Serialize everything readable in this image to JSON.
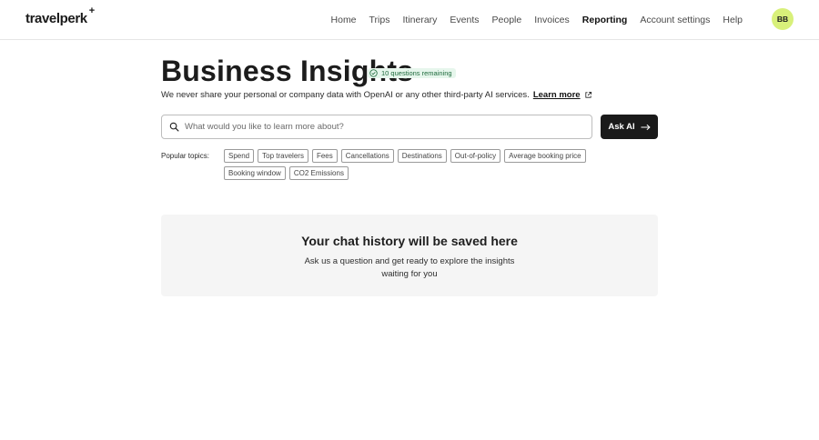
{
  "header": {
    "logo": "travelperk",
    "logo_plus": "+",
    "nav": [
      {
        "label": "Home",
        "active": false
      },
      {
        "label": "Trips",
        "active": false
      },
      {
        "label": "Itinerary",
        "active": false
      },
      {
        "label": "Events",
        "active": false
      },
      {
        "label": "People",
        "active": false
      },
      {
        "label": "Invoices",
        "active": false
      },
      {
        "label": "Reporting",
        "active": true
      },
      {
        "label": "Account settings",
        "active": false
      },
      {
        "label": "Help",
        "active": false
      }
    ],
    "avatar_initials": "BB",
    "avatar_color": "#d8f07a"
  },
  "main": {
    "title": "Business Insights",
    "quota_badge": "10 questions remaining",
    "privacy_text": "We never share your personal or company data with OpenAI or any other third-party AI services.",
    "learn_more": "Learn more",
    "search": {
      "placeholder": "What would you like to learn more about?",
      "value": "",
      "icon": "search-icon"
    },
    "ask_button": "Ask AI",
    "popular_label": "Popular topics:",
    "topics": [
      "Spend",
      "Top travelers",
      "Fees",
      "Cancellations",
      "Destinations",
      "Out-of-policy",
      "Average booking price",
      "Booking window",
      "CO2 Emissions"
    ],
    "history": {
      "title": "Your chat history will be saved here",
      "subtitle": "Ask us a question and get ready to explore the insights waiting for you"
    }
  }
}
